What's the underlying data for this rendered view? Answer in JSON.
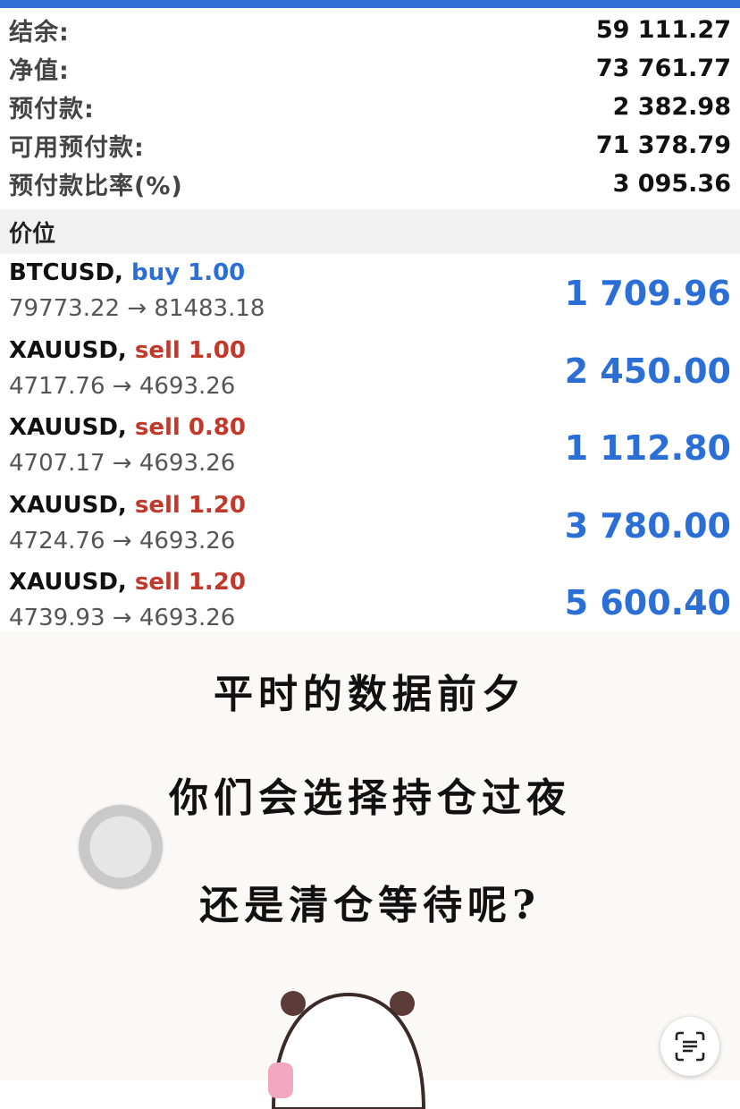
{
  "summary": {
    "rows": [
      {
        "label": "结余:",
        "value": "59 111.27"
      },
      {
        "label": "净值:",
        "value": "73 761.77"
      },
      {
        "label": "预付款:",
        "value": "2 382.98"
      },
      {
        "label": "可用预付款:",
        "value": "71 378.79"
      },
      {
        "label": "预付款比率(%)",
        "value": "3 095.36"
      }
    ]
  },
  "section": {
    "title": "价位"
  },
  "positions": [
    {
      "symbol": "BTCUSD,",
      "side": "buy 1.00",
      "prices": "79773.22 → 81483.18",
      "profit": "1 709.96"
    },
    {
      "symbol": "XAUUSD,",
      "side": "sell 1.00",
      "prices": "4717.76 → 4693.26",
      "profit": "2 450.00"
    },
    {
      "symbol": "XAUUSD,",
      "side": "sell 0.80",
      "prices": "4707.17 → 4693.26",
      "profit": "1 112.80"
    },
    {
      "symbol": "XAUUSD,",
      "side": "sell 1.20",
      "prices": "4724.76 → 4693.26",
      "profit": "3 780.00"
    },
    {
      "symbol": "XAUUSD,",
      "side": "sell 1.20",
      "prices": "4739.93 → 4693.26",
      "profit": "5 600.40"
    }
  ],
  "meme": {
    "line1": "平时的数据前夕",
    "line2": "你们会选择持仓过夜",
    "line3": "还是清仓等待呢?"
  },
  "colors": {
    "accent": "#2f6fd6",
    "buy": "#2a6ed6",
    "sell": "#c0392b",
    "profit": "#2a6ed6"
  },
  "icons": {
    "assistive_touch": "assistive-touch-icon",
    "scan": "scan-text-icon",
    "panda": "panda-sticker"
  }
}
